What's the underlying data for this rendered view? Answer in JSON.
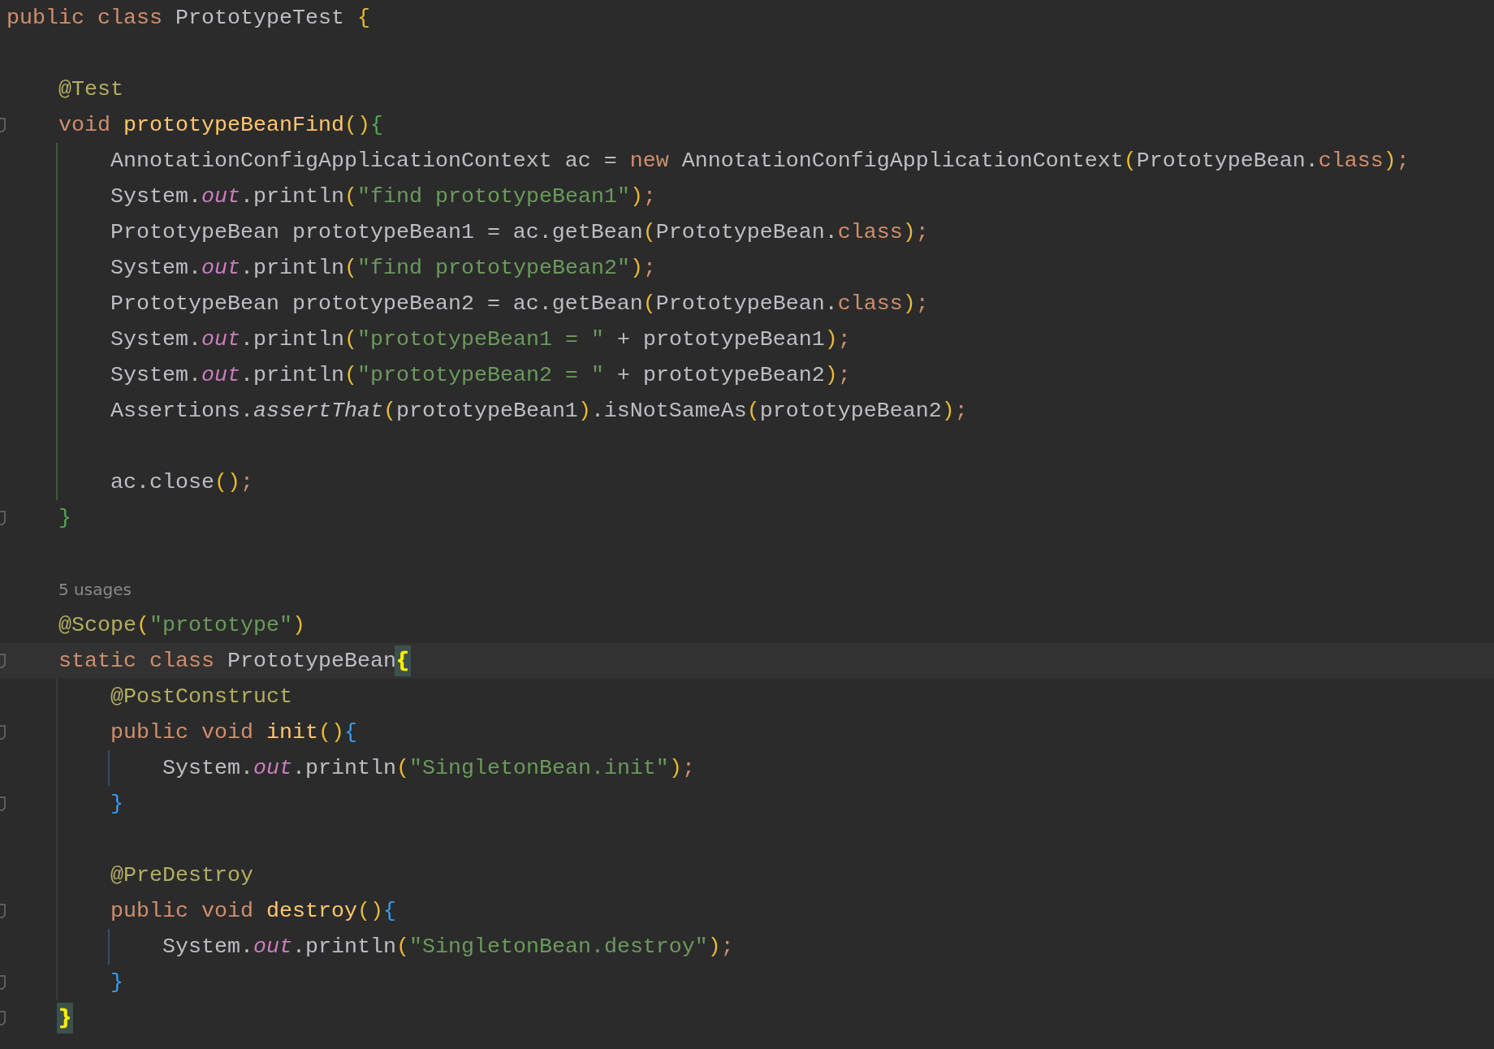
{
  "editor": {
    "lines": [
      {
        "kind": "code",
        "current": false,
        "fold": false,
        "tokens": [
          {
            "text": "public class ",
            "kind": "normal",
            "color": "#cf8e6d"
          },
          {
            "text": "PrototypeTest ",
            "kind": "normal",
            "color": "#bcbec4"
          },
          {
            "text": "{",
            "kind": "normal",
            "color": "#e8ba36"
          }
        ]
      },
      {
        "kind": "blank",
        "current": false,
        "fold": false
      },
      {
        "kind": "code",
        "current": false,
        "fold": false,
        "tokens": [
          {
            "text": "    @Test",
            "kind": "normal",
            "color": "#b3ae60"
          }
        ]
      },
      {
        "kind": "code",
        "current": false,
        "fold": true,
        "tokens": [
          {
            "text": "    void ",
            "kind": "normal",
            "color": "#cf8e6d"
          },
          {
            "text": "prototypeBeanFind",
            "kind": "normal",
            "color": "#ffc66d"
          },
          {
            "text": "()",
            "kind": "normal",
            "color": "#e8ba36"
          },
          {
            "text": "{",
            "kind": "normal",
            "color": "#54a857"
          }
        ]
      },
      {
        "kind": "code",
        "current": false,
        "fold": false,
        "guides": [
          {
            "kind": "method"
          }
        ],
        "tokens": [
          {
            "text": "        AnnotationConfigApplicationContext ac = ",
            "kind": "normal",
            "color": "#bcbec4"
          },
          {
            "text": "new ",
            "kind": "normal",
            "color": "#cf8e6d"
          },
          {
            "text": "AnnotationConfigApplicationContext",
            "kind": "normal",
            "color": "#bcbec4"
          },
          {
            "text": "(",
            "kind": "normal",
            "color": "#e8ba36"
          },
          {
            "text": "PrototypeBean.",
            "kind": "normal",
            "color": "#bcbec4"
          },
          {
            "text": "class",
            "kind": "normal",
            "color": "#cf8e6d"
          },
          {
            "text": ")",
            "kind": "normal",
            "color": "#e8ba36"
          },
          {
            "text": ";",
            "kind": "normal",
            "color": "#cf8e6d"
          }
        ]
      },
      {
        "kind": "code",
        "current": false,
        "fold": false,
        "guides": [
          {
            "kind": "method"
          }
        ],
        "tokens": [
          {
            "text": "        System.",
            "kind": "normal",
            "color": "#bcbec4"
          },
          {
            "text": "out",
            "kind": "italic",
            "color": "#c77dbb"
          },
          {
            "text": ".println",
            "kind": "normal",
            "color": "#bcbec4"
          },
          {
            "text": "(",
            "kind": "normal",
            "color": "#e8ba36"
          },
          {
            "text": "\"find prototypeBean1\"",
            "kind": "normal",
            "color": "#6a9a5b"
          },
          {
            "text": ")",
            "kind": "normal",
            "color": "#e8ba36"
          },
          {
            "text": ";",
            "kind": "normal",
            "color": "#cf8e6d"
          }
        ]
      },
      {
        "kind": "code",
        "current": false,
        "fold": false,
        "guides": [
          {
            "kind": "method"
          }
        ],
        "tokens": [
          {
            "text": "        PrototypeBean prototypeBean1 = ac.getBean",
            "kind": "normal",
            "color": "#bcbec4"
          },
          {
            "text": "(",
            "kind": "normal",
            "color": "#e8ba36"
          },
          {
            "text": "PrototypeBean.",
            "kind": "normal",
            "color": "#bcbec4"
          },
          {
            "text": "class",
            "kind": "normal",
            "color": "#cf8e6d"
          },
          {
            "text": ")",
            "kind": "normal",
            "color": "#e8ba36"
          },
          {
            "text": ";",
            "kind": "normal",
            "color": "#cf8e6d"
          }
        ]
      },
      {
        "kind": "code",
        "current": false,
        "fold": false,
        "guides": [
          {
            "kind": "method"
          }
        ],
        "tokens": [
          {
            "text": "        System.",
            "kind": "normal",
            "color": "#bcbec4"
          },
          {
            "text": "out",
            "kind": "italic",
            "color": "#c77dbb"
          },
          {
            "text": ".println",
            "kind": "normal",
            "color": "#bcbec4"
          },
          {
            "text": "(",
            "kind": "normal",
            "color": "#e8ba36"
          },
          {
            "text": "\"find prototypeBean2\"",
            "kind": "normal",
            "color": "#6a9a5b"
          },
          {
            "text": ")",
            "kind": "normal",
            "color": "#e8ba36"
          },
          {
            "text": ";",
            "kind": "normal",
            "color": "#cf8e6d"
          }
        ]
      },
      {
        "kind": "code",
        "current": false,
        "fold": false,
        "guides": [
          {
            "kind": "method"
          }
        ],
        "tokens": [
          {
            "text": "        PrototypeBean prototypeBean2 = ac.getBean",
            "kind": "normal",
            "color": "#bcbec4"
          },
          {
            "text": "(",
            "kind": "normal",
            "color": "#e8ba36"
          },
          {
            "text": "PrototypeBean.",
            "kind": "normal",
            "color": "#bcbec4"
          },
          {
            "text": "class",
            "kind": "normal",
            "color": "#cf8e6d"
          },
          {
            "text": ")",
            "kind": "normal",
            "color": "#e8ba36"
          },
          {
            "text": ";",
            "kind": "normal",
            "color": "#cf8e6d"
          }
        ]
      },
      {
        "kind": "code",
        "current": false,
        "fold": false,
        "guides": [
          {
            "kind": "method"
          }
        ],
        "tokens": [
          {
            "text": "        System.",
            "kind": "normal",
            "color": "#bcbec4"
          },
          {
            "text": "out",
            "kind": "italic",
            "color": "#c77dbb"
          },
          {
            "text": ".println",
            "kind": "normal",
            "color": "#bcbec4"
          },
          {
            "text": "(",
            "kind": "normal",
            "color": "#e8ba36"
          },
          {
            "text": "\"prototypeBean1 = \"",
            "kind": "normal",
            "color": "#6a9a5b"
          },
          {
            "text": " + prototypeBean1",
            "kind": "normal",
            "color": "#bcbec4"
          },
          {
            "text": ")",
            "kind": "normal",
            "color": "#e8ba36"
          },
          {
            "text": ";",
            "kind": "normal",
            "color": "#cf8e6d"
          }
        ]
      },
      {
        "kind": "code",
        "current": false,
        "fold": false,
        "guides": [
          {
            "kind": "method"
          }
        ],
        "tokens": [
          {
            "text": "        System.",
            "kind": "normal",
            "color": "#bcbec4"
          },
          {
            "text": "out",
            "kind": "italic",
            "color": "#c77dbb"
          },
          {
            "text": ".println",
            "kind": "normal",
            "color": "#bcbec4"
          },
          {
            "text": "(",
            "kind": "normal",
            "color": "#e8ba36"
          },
          {
            "text": "\"prototypeBean2 = \"",
            "kind": "normal",
            "color": "#6a9a5b"
          },
          {
            "text": " + prototypeBean2",
            "kind": "normal",
            "color": "#bcbec4"
          },
          {
            "text": ")",
            "kind": "normal",
            "color": "#e8ba36"
          },
          {
            "text": ";",
            "kind": "normal",
            "color": "#cf8e6d"
          }
        ]
      },
      {
        "kind": "code",
        "current": false,
        "fold": false,
        "guides": [
          {
            "kind": "method"
          }
        ],
        "tokens": [
          {
            "text": "        Assertions.",
            "kind": "normal",
            "color": "#bcbec4"
          },
          {
            "text": "assertThat",
            "kind": "italic",
            "color": "#bcbec4"
          },
          {
            "text": "(",
            "kind": "normal",
            "color": "#e8ba36"
          },
          {
            "text": "prototypeBean1",
            "kind": "normal",
            "color": "#bcbec4"
          },
          {
            "text": ")",
            "kind": "normal",
            "color": "#e8ba36"
          },
          {
            "text": ".isNotSameAs",
            "kind": "normal",
            "color": "#bcbec4"
          },
          {
            "text": "(",
            "kind": "normal",
            "color": "#e8ba36"
          },
          {
            "text": "prototypeBean2",
            "kind": "normal",
            "color": "#bcbec4"
          },
          {
            "text": ")",
            "kind": "normal",
            "color": "#e8ba36"
          },
          {
            "text": ";",
            "kind": "normal",
            "color": "#cf8e6d"
          }
        ]
      },
      {
        "kind": "blank",
        "current": false,
        "fold": false,
        "guides": [
          {
            "kind": "method"
          }
        ]
      },
      {
        "kind": "code",
        "current": false,
        "fold": false,
        "guides": [
          {
            "kind": "method"
          }
        ],
        "tokens": [
          {
            "text": "        ac.close",
            "kind": "normal",
            "color": "#bcbec4"
          },
          {
            "text": "()",
            "kind": "normal",
            "color": "#e8ba36"
          },
          {
            "text": ";",
            "kind": "normal",
            "color": "#cf8e6d"
          }
        ]
      },
      {
        "kind": "code",
        "current": false,
        "fold": true,
        "tokens": [
          {
            "text": "    }",
            "kind": "normal",
            "color": "#54a857"
          }
        ]
      },
      {
        "kind": "blank",
        "current": false,
        "fold": false
      },
      {
        "kind": "hint",
        "current": false,
        "fold": false,
        "text": "5 usages"
      },
      {
        "kind": "code",
        "current": false,
        "fold": false,
        "tokens": [
          {
            "text": "    @Scope",
            "kind": "normal",
            "color": "#b3ae60"
          },
          {
            "text": "(",
            "kind": "normal",
            "color": "#e8ba36"
          },
          {
            "text": "\"prototype\"",
            "kind": "normal",
            "color": "#6a9a5b"
          },
          {
            "text": ")",
            "kind": "normal",
            "color": "#e8ba36"
          }
        ]
      },
      {
        "kind": "code",
        "current": true,
        "fold": true,
        "tokens": [
          {
            "text": "    static class ",
            "kind": "normal",
            "color": "#cf8e6d"
          },
          {
            "text": "PrototypeBean",
            "kind": "normal",
            "color": "#bcbec4"
          },
          {
            "text": "{",
            "kind": "match",
            "color": "#fef000"
          }
        ]
      },
      {
        "kind": "code",
        "current": false,
        "fold": false,
        "guides": [
          {
            "kind": "class"
          }
        ],
        "tokens": [
          {
            "text": "        @PostConstruct",
            "kind": "normal",
            "color": "#b3ae60"
          }
        ]
      },
      {
        "kind": "code",
        "current": false,
        "fold": true,
        "guides": [
          {
            "kind": "class"
          }
        ],
        "tokens": [
          {
            "text": "        public void ",
            "kind": "normal",
            "color": "#cf8e6d"
          },
          {
            "text": "init",
            "kind": "normal",
            "color": "#ffc66d"
          },
          {
            "text": "()",
            "kind": "normal",
            "color": "#e8ba36"
          },
          {
            "text": "{",
            "kind": "normal",
            "color": "#359ff4"
          }
        ]
      },
      {
        "kind": "code",
        "current": false,
        "fold": false,
        "guides": [
          {
            "kind": "class"
          },
          {
            "kind": "inner"
          }
        ],
        "tokens": [
          {
            "text": "            System.",
            "kind": "normal",
            "color": "#bcbec4"
          },
          {
            "text": "out",
            "kind": "italic",
            "color": "#c77dbb"
          },
          {
            "text": ".println",
            "kind": "normal",
            "color": "#bcbec4"
          },
          {
            "text": "(",
            "kind": "normal",
            "color": "#e8ba36"
          },
          {
            "text": "\"SingletonBean.init\"",
            "kind": "normal",
            "color": "#6a9a5b"
          },
          {
            "text": ")",
            "kind": "normal",
            "color": "#e8ba36"
          },
          {
            "text": ";",
            "kind": "normal",
            "color": "#cf8e6d"
          }
        ]
      },
      {
        "kind": "code",
        "current": false,
        "fold": true,
        "guides": [
          {
            "kind": "class"
          }
        ],
        "tokens": [
          {
            "text": "        }",
            "kind": "normal",
            "color": "#359ff4"
          }
        ]
      },
      {
        "kind": "blank",
        "current": false,
        "fold": false,
        "guides": [
          {
            "kind": "class"
          }
        ]
      },
      {
        "kind": "code",
        "current": false,
        "fold": false,
        "guides": [
          {
            "kind": "class"
          }
        ],
        "tokens": [
          {
            "text": "        @PreDestroy",
            "kind": "normal",
            "color": "#b3ae60"
          }
        ]
      },
      {
        "kind": "code",
        "current": false,
        "fold": true,
        "guides": [
          {
            "kind": "class"
          }
        ],
        "tokens": [
          {
            "text": "        public void ",
            "kind": "normal",
            "color": "#cf8e6d"
          },
          {
            "text": "destroy",
            "kind": "normal",
            "color": "#ffc66d"
          },
          {
            "text": "()",
            "kind": "normal",
            "color": "#e8ba36"
          },
          {
            "text": "{",
            "kind": "normal",
            "color": "#359ff4"
          }
        ]
      },
      {
        "kind": "code",
        "current": false,
        "fold": false,
        "guides": [
          {
            "kind": "class"
          },
          {
            "kind": "inner"
          }
        ],
        "tokens": [
          {
            "text": "            System.",
            "kind": "normal",
            "color": "#bcbec4"
          },
          {
            "text": "out",
            "kind": "italic",
            "color": "#c77dbb"
          },
          {
            "text": ".println",
            "kind": "normal",
            "color": "#bcbec4"
          },
          {
            "text": "(",
            "kind": "normal",
            "color": "#e8ba36"
          },
          {
            "text": "\"SingletonBean.destroy\"",
            "kind": "normal",
            "color": "#6a9a5b"
          },
          {
            "text": ")",
            "kind": "normal",
            "color": "#e8ba36"
          },
          {
            "text": ";",
            "kind": "normal",
            "color": "#cf8e6d"
          }
        ]
      },
      {
        "kind": "code",
        "current": false,
        "fold": true,
        "guides": [
          {
            "kind": "class"
          }
        ],
        "tokens": [
          {
            "text": "        }",
            "kind": "normal",
            "color": "#359ff4"
          }
        ]
      },
      {
        "kind": "code",
        "current": false,
        "fold": true,
        "tokens": [
          {
            "text": "    }",
            "kind": "match",
            "color": "#fef000"
          }
        ]
      }
    ]
  }
}
